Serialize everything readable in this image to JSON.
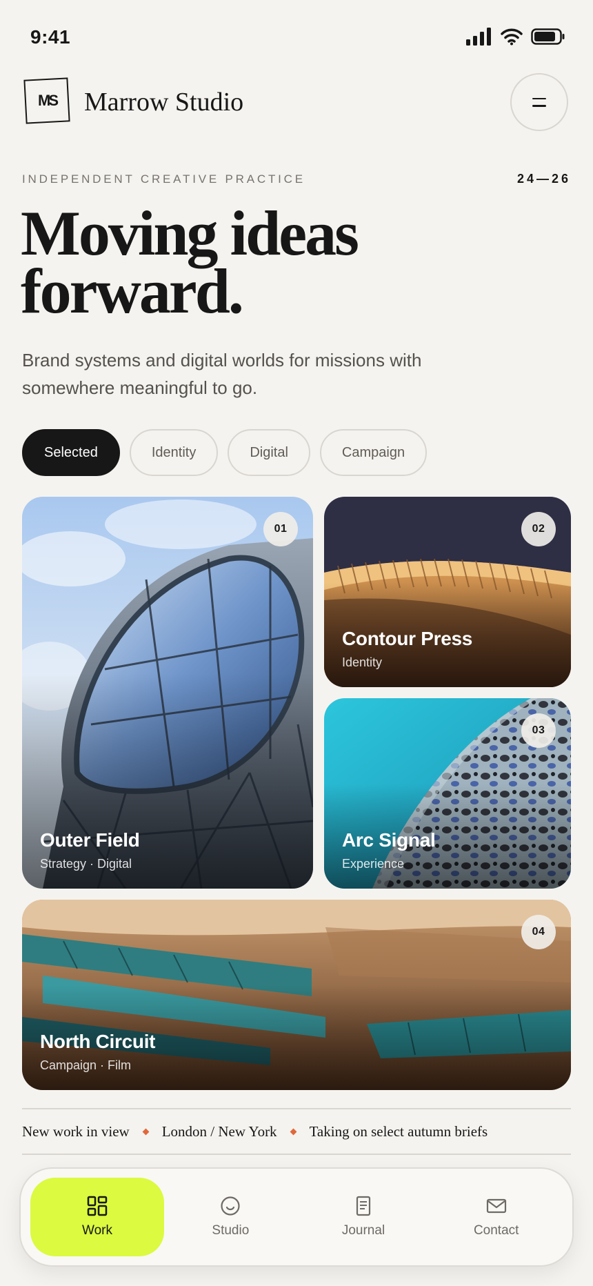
{
  "status_bar": {
    "time": "9:41"
  },
  "header": {
    "logo_text": "MS",
    "brand_name": "Marrow Studio"
  },
  "hero": {
    "eyebrow": "INDEPENDENT CREATIVE PRACTICE",
    "years": "24—26",
    "title_line1": "Moving ideas",
    "title_line2": "forward.",
    "subtitle": "Brand systems and digital worlds for missions with somewhere meaningful to go."
  },
  "filters": [
    {
      "label": "Selected",
      "active": true
    },
    {
      "label": "Identity",
      "active": false
    },
    {
      "label": "Digital",
      "active": false
    },
    {
      "label": "Campaign",
      "active": false
    }
  ],
  "projects": [
    {
      "number": "01",
      "title": "Outer Field",
      "tags": "Strategy · Digital"
    },
    {
      "number": "02",
      "title": "Contour Press",
      "tags": "Identity"
    },
    {
      "number": "03",
      "title": "Arc Signal",
      "tags": "Experience"
    },
    {
      "number": "04",
      "title": "North Circuit",
      "tags": "Campaign · Film"
    }
  ],
  "ticker": [
    "New work in view",
    "London / New York",
    "Taking on select autumn briefs"
  ],
  "bottom_nav": [
    {
      "label": "Work",
      "icon": "grid-icon",
      "active": true
    },
    {
      "label": "Studio",
      "icon": "smile-icon",
      "active": false
    },
    {
      "label": "Journal",
      "icon": "document-icon",
      "active": false
    },
    {
      "label": "Contact",
      "icon": "mail-icon",
      "active": false
    }
  ],
  "colors": {
    "background": "#f5f3ef",
    "ink": "#171717",
    "accent_lime": "#dcfa3f",
    "accent_orange": "#e0683c"
  }
}
